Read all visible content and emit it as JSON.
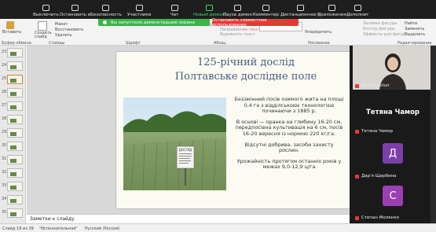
{
  "zoom_toolbar": {
    "items": [
      {
        "label": "Выключить"
      },
      {
        "label": "Остановить в"
      },
      {
        "label": "Безопасность"
      },
      {
        "label": "Участники"
      },
      {
        "label": "Чат"
      },
      {
        "label": "Новый демонс"
      },
      {
        "label": "Пауза демон"
      },
      {
        "label": "Комментир"
      },
      {
        "label": "Дистанционное у"
      },
      {
        "label": "Приложения"
      },
      {
        "label": "Дополнит"
      }
    ],
    "sharing_banner": "Вы запустили демонстрацию экрана",
    "stop_button": "Остановить совместное использование"
  },
  "ribbon": {
    "labels": [
      "Вставить",
      "Создать слайд",
      "Макет",
      "Восстановить",
      "Удалить",
      "Найти",
      "Заменить",
      "Выделить",
      "Направление текста",
      "Выровнять текст",
      "Преобразовать в SmartArt",
      "Заливка фигуры",
      "Контур фигуры",
      "Эффекты для фигур"
    ],
    "groups": [
      "Буфер обмена",
      "Слайды",
      "Шрифт",
      "Абзац",
      "Рисование",
      "Редактирование"
    ]
  },
  "slide_panel": {
    "numbers": [
      "23",
      "24",
      "25",
      "26",
      "27",
      "28",
      "29",
      "30",
      "31",
      "32",
      "33",
      "34",
      "35"
    ],
    "selected_index": 2
  },
  "slide": {
    "title_line1": "125-річний дослід",
    "title_line2": "Полтавське дослідне поле",
    "sign_text": "ДОСЛІД\nБезмінний посів\nозимого жита",
    "paragraphs": [
      "Беззмінний посів озимого жита на площі 0,4 га з відділськоює технологією починаючи з 1885 р.",
      "В основі — оранка на глибину 16-20 см, передпосівна культивація на 6 см, посів 16-20 вересня із нормою 220 кг/га.",
      "Відсутні добрива, засоби захисту рослин.",
      "Урожайність протягом останніх років у межах 9,0-12,9 ц/га"
    ]
  },
  "notes_placeholder": "Заметки к слайду",
  "status_bar": {
    "slide_info": "Слайд 19 из 39",
    "theme": "\"Исполнительная\"",
    "language": "Русский (Россия)"
  },
  "participants": [
    {
      "name": "Daria Kovtun",
      "has_video": true
    },
    {
      "name": "Тетяна Чамор",
      "big_label": "Тетяна Чамор",
      "has_video": false
    },
    {
      "name": "Дар'я Щербина",
      "initial": "Д",
      "color": "#7b3fa8"
    },
    {
      "name": "Степан Моленко",
      "initial": "С",
      "color": "#9c3fb5"
    }
  ]
}
